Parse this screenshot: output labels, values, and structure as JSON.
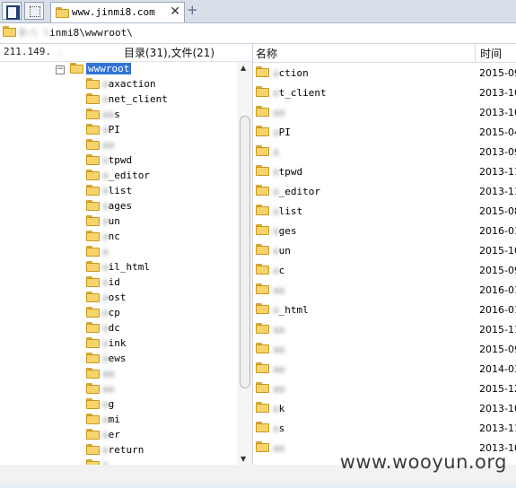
{
  "tabbar": {
    "tab_title": "www.jinmi8.com",
    "close_glyph": "✕",
    "new_tab_glyph": "+"
  },
  "pathbar": {
    "path_blur": "D:\\   \\",
    "path_clear": "inmi8\\wwwroot\\"
  },
  "left_panel": {
    "ip_clear": "211.149.",
    "ip_blur": "  .  ",
    "count_label": "目录(31),文件(21)",
    "root_expander": "−",
    "root_label": "wwwroot",
    "tree_items": [
      {
        "blur": "a",
        "clear": "axaction"
      },
      {
        "blur": "a",
        "clear": "net_client"
      },
      {
        "blur": "aa",
        "clear": "s"
      },
      {
        "blur": "a",
        "clear": "PI"
      },
      {
        "blur": "aa",
        "clear": ""
      },
      {
        "blur": "a",
        "clear": "tpwd"
      },
      {
        "blur": "a",
        "clear": "_editor"
      },
      {
        "blur": "a",
        "clear": "list"
      },
      {
        "blur": "a",
        "clear": "ages"
      },
      {
        "blur": "a",
        "clear": "un"
      },
      {
        "blur": "a",
        "clear": "nc"
      },
      {
        "blur": "a",
        "clear": ""
      },
      {
        "blur": "a",
        "clear": "il_html"
      },
      {
        "blur": "a",
        "clear": "id"
      },
      {
        "blur": "a",
        "clear": "ost"
      },
      {
        "blur": "a",
        "clear": "cp"
      },
      {
        "blur": "a",
        "clear": "dc"
      },
      {
        "blur": "a",
        "clear": "ink"
      },
      {
        "blur": "a",
        "clear": "ews"
      },
      {
        "blur": "aa",
        "clear": ""
      },
      {
        "blur": "aa",
        "clear": ""
      },
      {
        "blur": "a",
        "clear": "g"
      },
      {
        "blur": "a",
        "clear": "mi"
      },
      {
        "blur": "a",
        "clear": "er"
      },
      {
        "blur": "a",
        "clear": "return"
      },
      {
        "blur": "a",
        "clear": ""
      }
    ]
  },
  "right_panel": {
    "col_name": "名称",
    "col_time": "时间",
    "rows": [
      {
        "blur": "a",
        "clear": "ction",
        "time": "2015-09"
      },
      {
        "blur": "a",
        "clear": "t_client",
        "time": "2013-10"
      },
      {
        "blur": "aa",
        "clear": "",
        "time": "2013-10"
      },
      {
        "blur": "a",
        "clear": "PI",
        "time": "2015-04"
      },
      {
        "blur": "a",
        "clear": "",
        "time": "2013-09"
      },
      {
        "blur": "a",
        "clear": "tpwd",
        "time": "2013-11"
      },
      {
        "blur": "a",
        "clear": "_editor",
        "time": "2013-11"
      },
      {
        "blur": "a",
        "clear": "list",
        "time": "2015-08"
      },
      {
        "blur": "a",
        "clear": "ges",
        "time": "2016-01"
      },
      {
        "blur": "a",
        "clear": "un",
        "time": "2015-10"
      },
      {
        "blur": "a",
        "clear": "c",
        "time": "2015-09"
      },
      {
        "blur": "aa",
        "clear": "",
        "time": "2016-01"
      },
      {
        "blur": "a",
        "clear": "_html",
        "time": "2016-01"
      },
      {
        "blur": "aa",
        "clear": "",
        "time": "2015-11"
      },
      {
        "blur": "aa",
        "clear": "",
        "time": "2015-09"
      },
      {
        "blur": "aa",
        "clear": "",
        "time": "2014-03"
      },
      {
        "blur": "aa",
        "clear": "",
        "time": "2015-12"
      },
      {
        "blur": "a",
        "clear": "k",
        "time": "2013-10"
      },
      {
        "blur": "a",
        "clear": "s",
        "time": "2013-11"
      },
      {
        "blur": "aa",
        "clear": "",
        "time": "2013-10"
      }
    ]
  },
  "watermark": "www.wooyun.org"
}
